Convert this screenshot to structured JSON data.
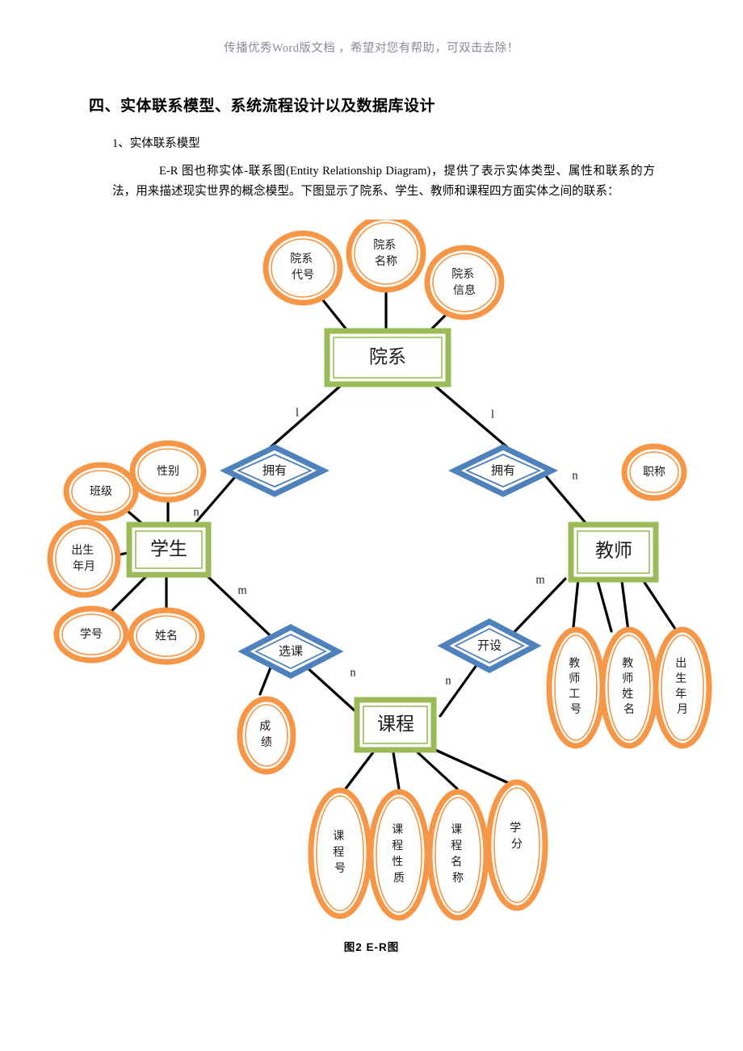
{
  "watermark": {
    "text": "传播优秀Word版文档 ，希望对您有帮助，可双击去除！"
  },
  "document": {
    "title": "四、实体联系模型、系统流程设计以及数据库设计",
    "section_label": "1、实体联系模型",
    "paragraph": "E-R 图也称实体-联系图(Entity Relationship Diagram)，提供了表示实体类型、属性和联系的方法，用来描述现实世界的概念模型。下图显示了院系、学生、教师和课程四方面实体之间的联系：",
    "figure_caption": "图2   E-R图"
  },
  "colors": {
    "entity_border": "#9BBB59",
    "entity_inner": "#9BBB59",
    "attribute_border": "#F79646",
    "relationship_border": "#4F81BD",
    "link": "#000000",
    "watermark_text": "#8a8a99"
  },
  "er_diagram": {
    "entities": [
      {
        "id": "dept",
        "label": "院系"
      },
      {
        "id": "student",
        "label": "学生"
      },
      {
        "id": "teacher",
        "label": "教师"
      },
      {
        "id": "course",
        "label": "课程"
      }
    ],
    "relationships": [
      {
        "id": "own-left",
        "label": "拥有"
      },
      {
        "id": "own-right",
        "label": "拥有"
      },
      {
        "id": "select",
        "label": "选课"
      },
      {
        "id": "offer",
        "label": "开设"
      }
    ],
    "attributes": [
      {
        "id": "dept-code",
        "label": "院系\n代号",
        "owner": "dept"
      },
      {
        "id": "dept-name",
        "label": "院系\n名称",
        "owner": "dept"
      },
      {
        "id": "dept-info",
        "label": "院系\n信息",
        "owner": "dept"
      },
      {
        "id": "class",
        "label": "班级",
        "owner": "student"
      },
      {
        "id": "gender",
        "label": "性别",
        "owner": "student"
      },
      {
        "id": "birth-stu",
        "label": "出生\n年月",
        "owner": "student"
      },
      {
        "id": "student-no",
        "label": "学号",
        "owner": "student"
      },
      {
        "id": "student-name",
        "label": "姓名",
        "owner": "student"
      },
      {
        "id": "title-rank",
        "label": "职称",
        "owner": "teacher"
      },
      {
        "id": "teacher-no",
        "label": "教师工号",
        "owner": "teacher"
      },
      {
        "id": "teacher-name",
        "label": "教师姓名",
        "owner": "teacher"
      },
      {
        "id": "birth-tea",
        "label": "出生年月",
        "owner": "teacher"
      },
      {
        "id": "score",
        "label": "成绩",
        "owner": "select"
      },
      {
        "id": "course-no",
        "label": "课程号",
        "owner": "course"
      },
      {
        "id": "course-type",
        "label": "课程性质",
        "owner": "course"
      },
      {
        "id": "course-name",
        "label": "课程名称",
        "owner": "course"
      },
      {
        "id": "credit",
        "label": "学分",
        "owner": "course"
      }
    ],
    "cardinalities": [
      {
        "id": "card-dept-own-left",
        "value": "l"
      },
      {
        "id": "card-dept-own-right",
        "value": "l"
      },
      {
        "id": "card-student-own",
        "value": "n"
      },
      {
        "id": "card-teacher-own",
        "value": "n"
      },
      {
        "id": "card-student-select",
        "value": "m"
      },
      {
        "id": "card-course-select",
        "value": "n"
      },
      {
        "id": "card-teacher-offer",
        "value": "m"
      },
      {
        "id": "card-course-offer",
        "value": "n"
      }
    ]
  }
}
